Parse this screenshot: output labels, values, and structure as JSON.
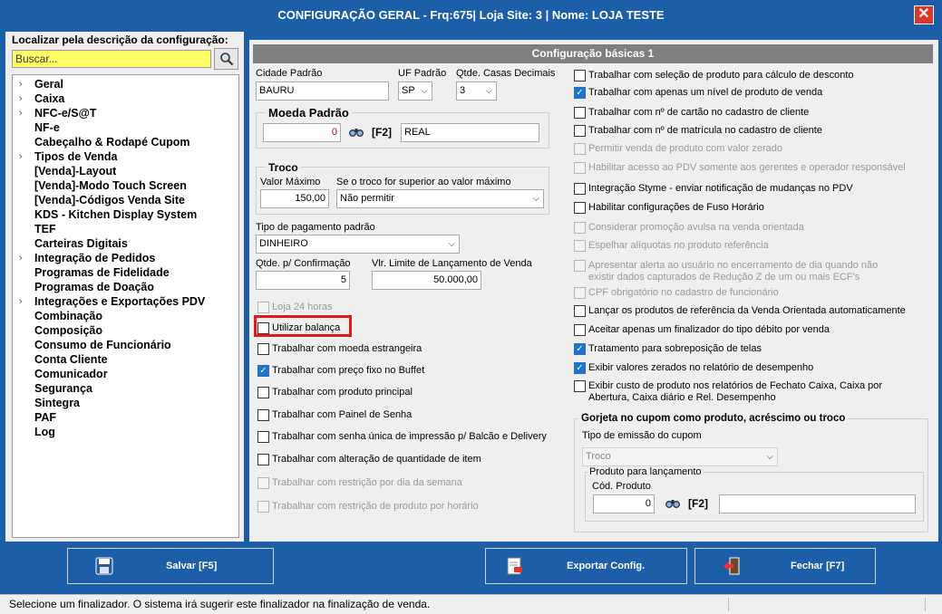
{
  "window": {
    "title": "CONFIGURAÇÃO GERAL - Frq:675| Loja Site: 3 | Nome: LOJA TESTE",
    "close_glyph": "✕"
  },
  "sidebar": {
    "search_label": "Localizar pela descrição da configuração:",
    "search_placeholder": "Buscar...",
    "items": [
      {
        "label": "Geral",
        "has_children": true
      },
      {
        "label": "Caixa",
        "has_children": true
      },
      {
        "label": "NFC-e/S@T",
        "has_children": true
      },
      {
        "label": "NF-e",
        "has_children": false
      },
      {
        "label": "Cabeçalho & Rodapé Cupom",
        "has_children": false
      },
      {
        "label": "Tipos de Venda",
        "has_children": true
      },
      {
        "label": "[Venda]-Layout",
        "has_children": false
      },
      {
        "label": "[Venda]-Modo Touch Screen",
        "has_children": false
      },
      {
        "label": "[Venda]-Códigos Venda Site",
        "has_children": false
      },
      {
        "label": "KDS - Kitchen Display System",
        "has_children": false
      },
      {
        "label": "TEF",
        "has_children": false
      },
      {
        "label": "Carteiras Digitais",
        "has_children": false
      },
      {
        "label": "Integração de Pedidos",
        "has_children": true
      },
      {
        "label": "Programas de Fidelidade",
        "has_children": false
      },
      {
        "label": "Programas de Doação",
        "has_children": false
      },
      {
        "label": "Integrações e Exportações PDV",
        "has_children": true
      },
      {
        "label": "Combinação",
        "has_children": false
      },
      {
        "label": "Composição",
        "has_children": false
      },
      {
        "label": "Consumo de Funcionário",
        "has_children": false
      },
      {
        "label": "Conta Cliente",
        "has_children": false
      },
      {
        "label": "Comunicador",
        "has_children": false
      },
      {
        "label": "Segurança",
        "has_children": false
      },
      {
        "label": "Sintegra",
        "has_children": false
      },
      {
        "label": "PAF",
        "has_children": false
      },
      {
        "label": "Log",
        "has_children": false
      }
    ]
  },
  "main": {
    "section_title": "Configuração básicas 1",
    "cidade": {
      "label": "Cidade Padrão",
      "value": "BAURU"
    },
    "uf": {
      "label": "UF Padrão",
      "value": "SP"
    },
    "casas": {
      "label": "Qtde. Casas Decimais",
      "value": "3"
    },
    "moeda": {
      "title": "Moeda Padrão",
      "code": "0",
      "f2": "[F2]",
      "name": "REAL"
    },
    "troco": {
      "title": "Troco",
      "valor_label": "Valor Máximo",
      "valor": "150,00",
      "acao_label": "Se o troco for superior ao valor máximo",
      "acao": "Não permitir"
    },
    "pagamento": {
      "label": "Tipo de pagamento padrão",
      "value": "DINHEIRO"
    },
    "confirmacao": {
      "label": "Qtde. p/ Confirmação",
      "value": "5"
    },
    "limite": {
      "label": "Vlr. Limite de Lançamento de Venda",
      "value": "50.000,00"
    },
    "left_checks": [
      {
        "label": "Loja 24 horas",
        "checked": false,
        "disabled": true
      },
      {
        "label": "Utilizar balança",
        "checked": false,
        "disabled": false
      },
      {
        "label": "Trabalhar com moeda estrangeira",
        "checked": false,
        "disabled": false
      },
      {
        "label": "Trabalhar com preço fixo no Buffet",
        "checked": true,
        "disabled": false
      },
      {
        "label": "Trabalhar com produto principal",
        "checked": false,
        "disabled": false
      },
      {
        "label": "Trabalhar com Painel de Senha",
        "checked": false,
        "disabled": false
      },
      {
        "label": "Trabalhar com senha única de impressão p/ Balcão e Delivery",
        "checked": false,
        "disabled": false
      },
      {
        "label": "Trabalhar com alteração de quantidade de item",
        "checked": false,
        "disabled": false
      },
      {
        "label": "Trabalhar com restrição por dia da semana",
        "checked": false,
        "disabled": true
      },
      {
        "label": "Trabalhar com restrição de produto por horário",
        "checked": false,
        "disabled": true
      }
    ],
    "right_checks": [
      {
        "label": "Trabalhar com seleção de produto para cálculo de desconto",
        "checked": false,
        "disabled": false
      },
      {
        "label": "Trabalhar com apenas um nível de produto de venda",
        "checked": true,
        "disabled": false
      },
      {
        "label": "Trabalhar com nº de cartão no cadastro de cliente",
        "checked": false,
        "disabled": false
      },
      {
        "label": "Trabalhar com nº de matrícula no cadastro de cliente",
        "checked": false,
        "disabled": false
      },
      {
        "label": "Permitir venda de produto com valor zerado",
        "checked": false,
        "disabled": true
      },
      {
        "label": "Habilitar acesso ao PDV somente aos gerentes e operador responsável",
        "checked": false,
        "disabled": true
      },
      {
        "label": "Integração Styme - enviar notificação de mudanças no PDV",
        "checked": false,
        "disabled": false
      },
      {
        "label": "Habilitar configurações de Fuso Horário",
        "checked": false,
        "disabled": false
      },
      {
        "label": "Considerar promoção avulsa na venda orientada",
        "checked": false,
        "disabled": true
      },
      {
        "label": "Espelhar alíquotas no produto referência",
        "checked": false,
        "disabled": true
      },
      {
        "label": "Apresentar alerta ao usuário no encerramento de dia quando não",
        "label2": "existir dados capturados de Redução Z de um ou mais ECF's",
        "checked": false,
        "disabled": true
      },
      {
        "label": "CPF obrigatório no cadastro de funcionário",
        "checked": false,
        "disabled": true
      },
      {
        "label": "Lançar os produtos de referência da Venda Orientada automaticamente",
        "checked": false,
        "disabled": false
      },
      {
        "label": "Aceitar apenas um finalizador do tipo débito por venda",
        "checked": false,
        "disabled": false
      },
      {
        "label": "Tratamento para sobreposição de telas",
        "checked": true,
        "disabled": false
      },
      {
        "label": "Exibir valores zerados no relatório de desempenho",
        "checked": true,
        "disabled": false
      },
      {
        "label": "Exibir custo de produto nos relatórios de Fechato Caixa, Caixa por",
        "label2": "Abertura, Caixa diário e Rel. Desempenho",
        "checked": false,
        "disabled": false
      }
    ],
    "gorjeta": {
      "title": "Gorjeta no cupom como produto, acréscimo ou troco",
      "tipo_label": "Tipo de emissão do cupom",
      "tipo_value": "Troco",
      "produto_title": "Produto para lançamento",
      "cod_label": "Cód. Produto",
      "cod_value": "0",
      "f2": "[F2]",
      "nome": ""
    }
  },
  "footer": {
    "save_label": "Salvar [F5]",
    "export_label": "Exportar Config.",
    "close_label": "Fechar [F7]"
  },
  "status": {
    "text": "Selecione um finalizador. O sistema irá sugerir este finalizador na finalização de venda."
  },
  "colors": {
    "titlebar": "#1c5ea8",
    "highlight_box": "#e01b1b",
    "search_bg": "#ffff66",
    "check_accent": "#1f73c9"
  }
}
